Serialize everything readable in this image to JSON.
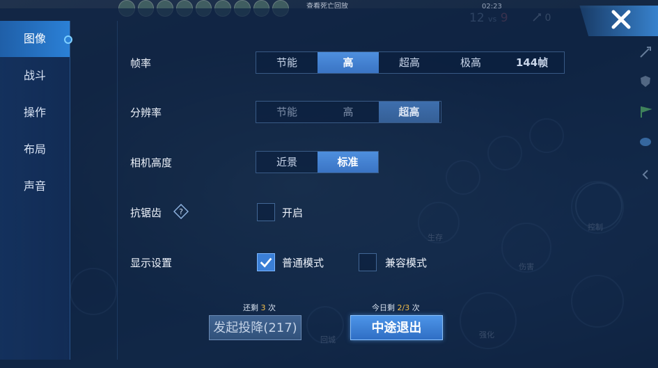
{
  "hud": {
    "replay_text": "查看死亡回放",
    "clock": "02:23",
    "score_left": "12",
    "score_vs": "vs",
    "score_right": "9",
    "kills": "0",
    "skills": {
      "control": "控制",
      "damage": "伤害",
      "survive": "生存",
      "enhance": "强化",
      "recall": "回城"
    }
  },
  "sidebar": {
    "items": [
      {
        "label": "图像",
        "active": true
      },
      {
        "label": "战斗",
        "active": false
      },
      {
        "label": "操作",
        "active": false
      },
      {
        "label": "布局",
        "active": false
      },
      {
        "label": "声音",
        "active": false
      }
    ]
  },
  "settings": {
    "frame_rate": {
      "label": "帧率",
      "options": [
        "节能",
        "高",
        "超高",
        "极高",
        "144帧"
      ],
      "selected": "高"
    },
    "resolution": {
      "label": "分辨率",
      "options": [
        "节能",
        "高",
        "超高"
      ],
      "selected": "超高"
    },
    "camera_height": {
      "label": "相机高度",
      "options": [
        "近景",
        "标准"
      ],
      "selected": "标准"
    },
    "anti_aliasing": {
      "label": "抗锯齿",
      "option_label": "开启",
      "checked": false
    },
    "display": {
      "label": "显示设置",
      "normal_label": "普通模式",
      "normal_checked": true,
      "compat_label": "兼容模式",
      "compat_checked": false
    }
  },
  "actions": {
    "surrender_remaining_prefix": "还剩",
    "surrender_remaining_count": "3",
    "surrender_remaining_suffix": "次",
    "surrender_button": "发起投降(217)",
    "quit_remaining_prefix": "今日剩",
    "quit_remaining_count": "2/3",
    "quit_remaining_suffix": "次",
    "quit_button": "中途退出"
  },
  "colors": {
    "accent": "#3b7fd6",
    "highlight": "#f5c04a",
    "panel": "#0e2242"
  }
}
